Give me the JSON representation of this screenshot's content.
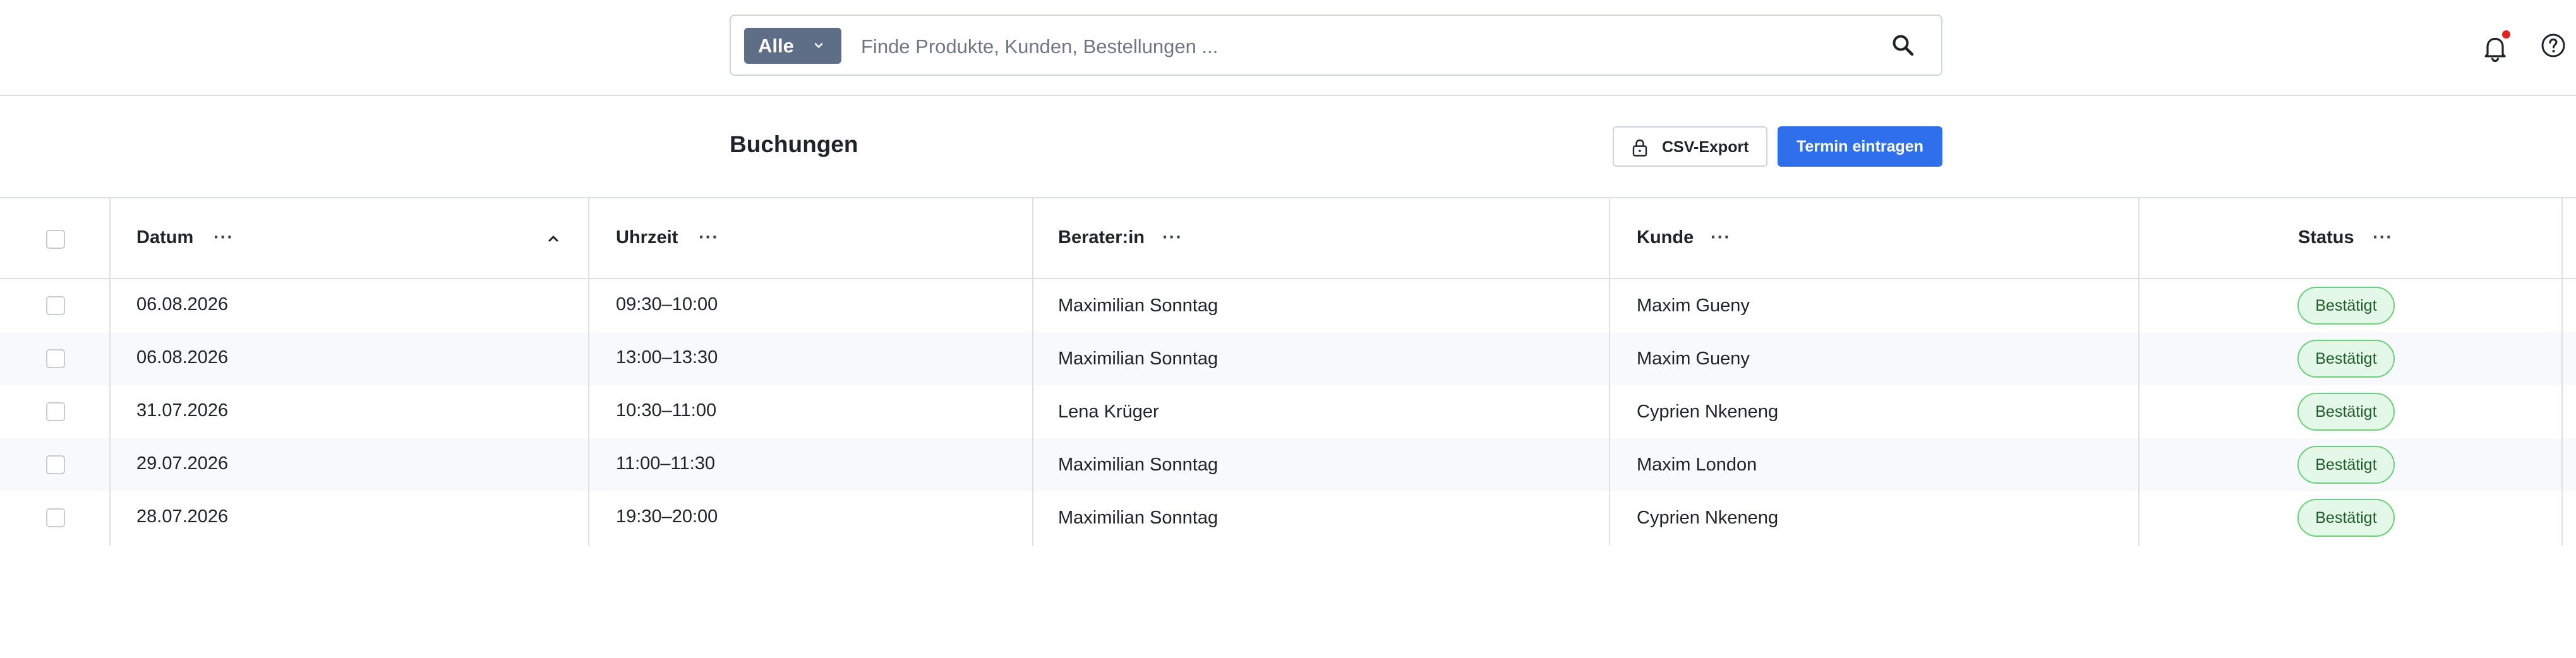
{
  "topbar": {
    "filter_label": "Alle",
    "search_placeholder": "Finde Produkte, Kunden, Bestellungen ...",
    "notifications_unread": true
  },
  "page": {
    "title": "Buchungen",
    "export_label": "CSV-Export",
    "primary_label": "Termin eintragen"
  },
  "table": {
    "columns": [
      {
        "label": "Datum",
        "menu": "···",
        "sorted": "ascending"
      },
      {
        "label": "Uhrzeit",
        "menu": "···"
      },
      {
        "label": "Berater:in",
        "menu": "···"
      },
      {
        "label": "Kunde",
        "menu": "···"
      },
      {
        "label": "Status",
        "menu": "···"
      }
    ],
    "rows": [
      {
        "date": "06.08.2026",
        "time": "09:30–10:00",
        "advisor": "Maximilian Sonntag",
        "customer": "Maxim Gueny",
        "status": "Bestätigt"
      },
      {
        "date": "06.08.2026",
        "time": "13:00–13:30",
        "advisor": "Maximilian Sonntag",
        "customer": "Maxim Gueny",
        "status": "Bestätigt"
      },
      {
        "date": "31.07.2026",
        "time": "10:30–11:00",
        "advisor": "Lena Krüger",
        "customer": "Cyprien Nkeneng",
        "status": "Bestätigt"
      },
      {
        "date": "29.07.2026",
        "time": "11:00–11:30",
        "advisor": "Maximilian Sonntag",
        "customer": "Maxim London",
        "status": "Bestätigt"
      },
      {
        "date": "28.07.2026",
        "time": "19:30–20:00",
        "advisor": "Maximilian Sonntag",
        "customer": "Cyprien Nkeneng",
        "status": "Bestätigt"
      }
    ]
  },
  "colors": {
    "primary": "#2f6feb",
    "filter": "#5e6e86",
    "status_bg": "#e3f8e6",
    "status_border": "#6ccf7e",
    "notification_dot": "#e02424"
  },
  "icons": [
    "chevron-down-icon",
    "search-icon",
    "bell-icon",
    "help-icon",
    "lock-icon",
    "sort-ascending-icon",
    "more-icon"
  ]
}
